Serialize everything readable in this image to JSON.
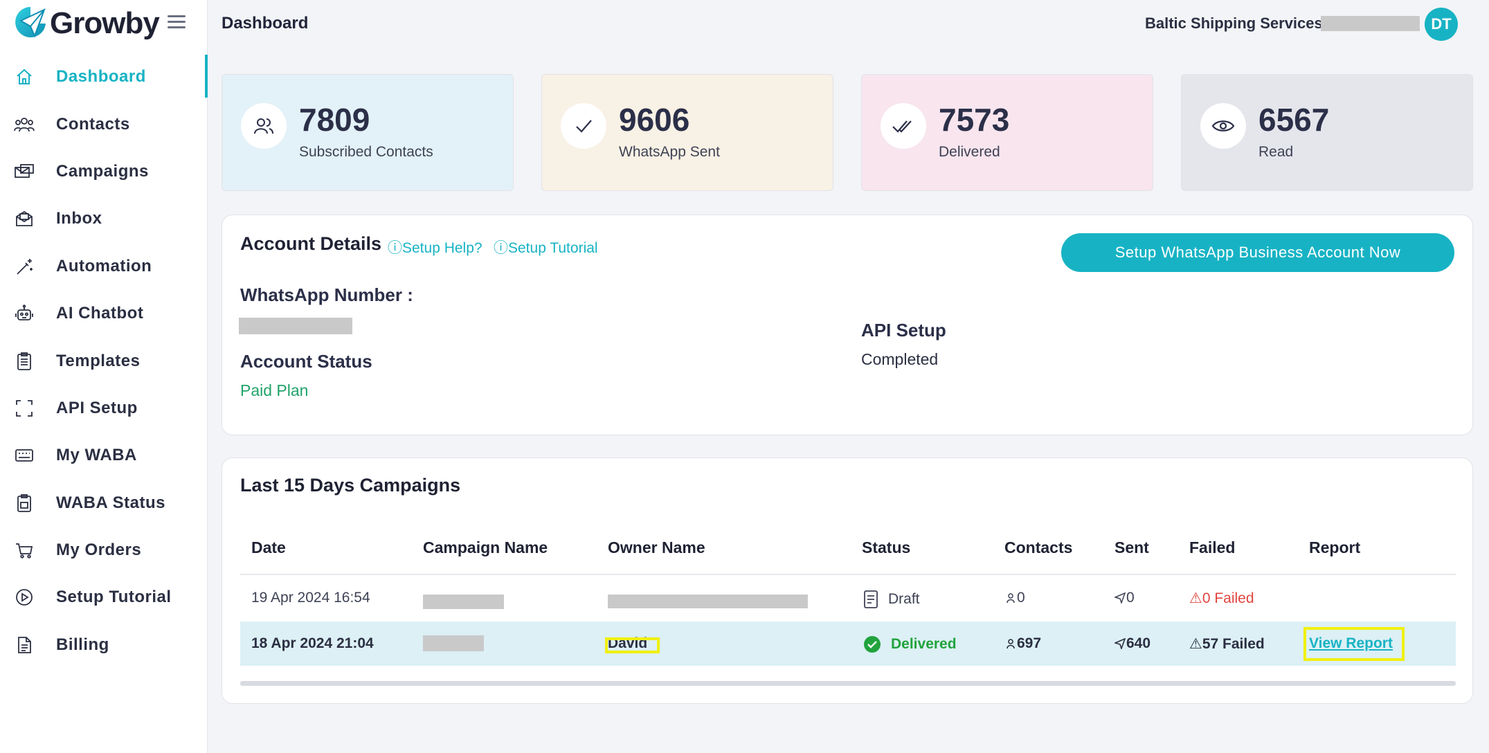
{
  "brand": {
    "name": "Growby",
    "logo_icon": "paper-plane-logo",
    "menu_icon": "hamburger-icon"
  },
  "colors": {
    "accent": "#17b3c4",
    "failed": "#e0443e",
    "delivered": "#21a33d",
    "highlight": "#f0f00f"
  },
  "sidebar": {
    "items": [
      {
        "label": "Dashboard",
        "icon": "home-icon",
        "active": true
      },
      {
        "label": "Contacts",
        "icon": "users-icon"
      },
      {
        "label": "Campaigns",
        "icon": "campaigns-icon"
      },
      {
        "label": "Inbox",
        "icon": "inbox-icon"
      },
      {
        "label": "Automation",
        "icon": "magic-wand-icon"
      },
      {
        "label": "AI Chatbot",
        "icon": "robot-icon"
      },
      {
        "label": "Templates",
        "icon": "clipboard-icon"
      },
      {
        "label": "API Setup",
        "icon": "scan-frame-icon"
      },
      {
        "label": "My WABA",
        "icon": "keyboard-icon"
      },
      {
        "label": "WABA Status",
        "icon": "clipboard-status-icon"
      },
      {
        "label": "My Orders",
        "icon": "cart-icon"
      },
      {
        "label": "Setup Tutorial",
        "icon": "play-circle-icon"
      },
      {
        "label": "Billing",
        "icon": "document-icon"
      }
    ]
  },
  "header": {
    "title": "Dashboard",
    "org_name": "Baltic Shipping Services -",
    "avatar_initials": "DT"
  },
  "stats": [
    {
      "value": "7809",
      "label": "Subscribed Contacts",
      "icon": "users-icon",
      "bg": "#e3f1f8"
    },
    {
      "value": "9606",
      "label": "WhatsApp Sent",
      "icon": "check-icon",
      "bg": "#f8f1e5"
    },
    {
      "value": "7573",
      "label": "Delivered",
      "icon": "double-check-icon",
      "bg": "#f8e5ee"
    },
    {
      "value": "6567",
      "label": "Read",
      "icon": "eye-icon",
      "bg": "#e5e6ec"
    }
  ],
  "account": {
    "title": "Account Details",
    "help_link": "Setup Help?",
    "tutorial_link": "Setup Tutorial",
    "setup_button": "Setup WhatsApp Business Account Now",
    "whatsapp_number_label": "WhatsApp Number :",
    "status_label": "Account Status",
    "status_value": "Paid Plan",
    "api_label": "API Setup",
    "api_value": "Completed"
  },
  "campaigns": {
    "title": "Last 15 Days Campaigns",
    "columns": [
      "Date",
      "Campaign Name",
      "Owner Name",
      "Status",
      "Contacts",
      "Sent",
      "Failed",
      "Report"
    ],
    "rows": [
      {
        "date": "19 Apr 2024 16:54",
        "status": "Draft",
        "contacts": "0",
        "sent": "0",
        "failed": "0 Failed",
        "report": ""
      },
      {
        "date": "18 Apr 2024 21:04",
        "owner": "David",
        "status": "Delivered",
        "contacts": "697",
        "sent": "640",
        "failed": "57 Failed",
        "report": "View Report"
      }
    ]
  }
}
